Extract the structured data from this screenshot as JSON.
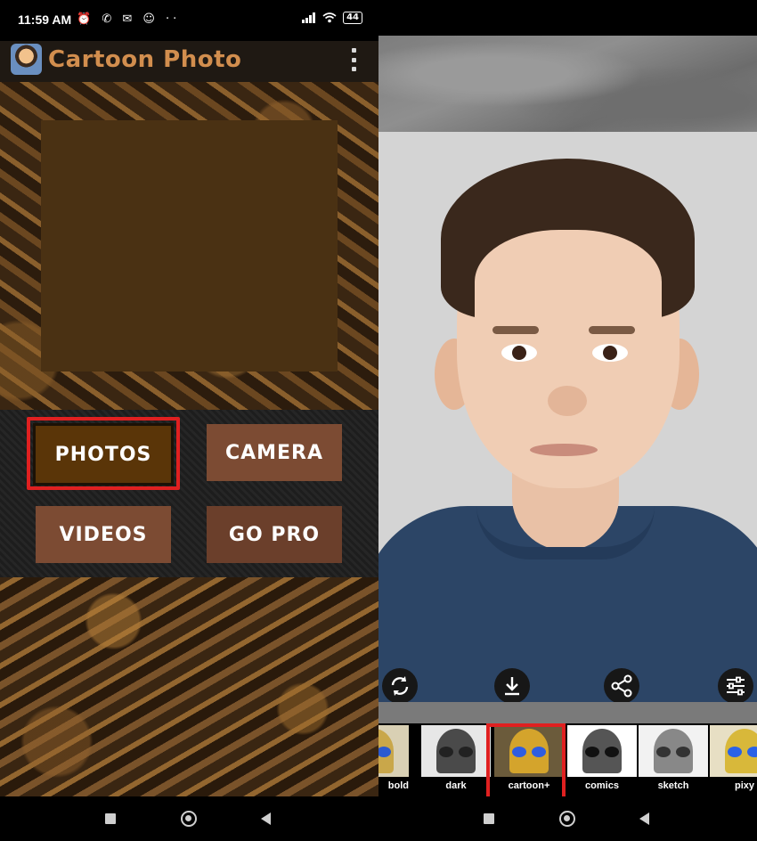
{
  "status": {
    "time": "11:59 AM",
    "notification_icons": "⏰ ✆ ✉ ☺ ··",
    "signal": "📶",
    "wifi": "wifi",
    "battery": "44"
  },
  "left_app": {
    "title": "Cartoon Photo",
    "buttons": {
      "photos": "PHOTOS",
      "camera": "CAMERA",
      "videos": "VIDEOS",
      "gopro": "GO PRO"
    },
    "highlight_color": "#e02020"
  },
  "right_app": {
    "actions": {
      "rotate_icon": "rotate-icon",
      "download_icon": "download-icon",
      "share_icon": "share-icon",
      "adjust_icon": "sliders-icon"
    },
    "filters": [
      {
        "label": "bold"
      },
      {
        "label": "dark"
      },
      {
        "label": "cartoon+"
      },
      {
        "label": "comics"
      },
      {
        "label": "sketch"
      },
      {
        "label": "pixy"
      }
    ],
    "selected_filter": "cartoon+"
  }
}
